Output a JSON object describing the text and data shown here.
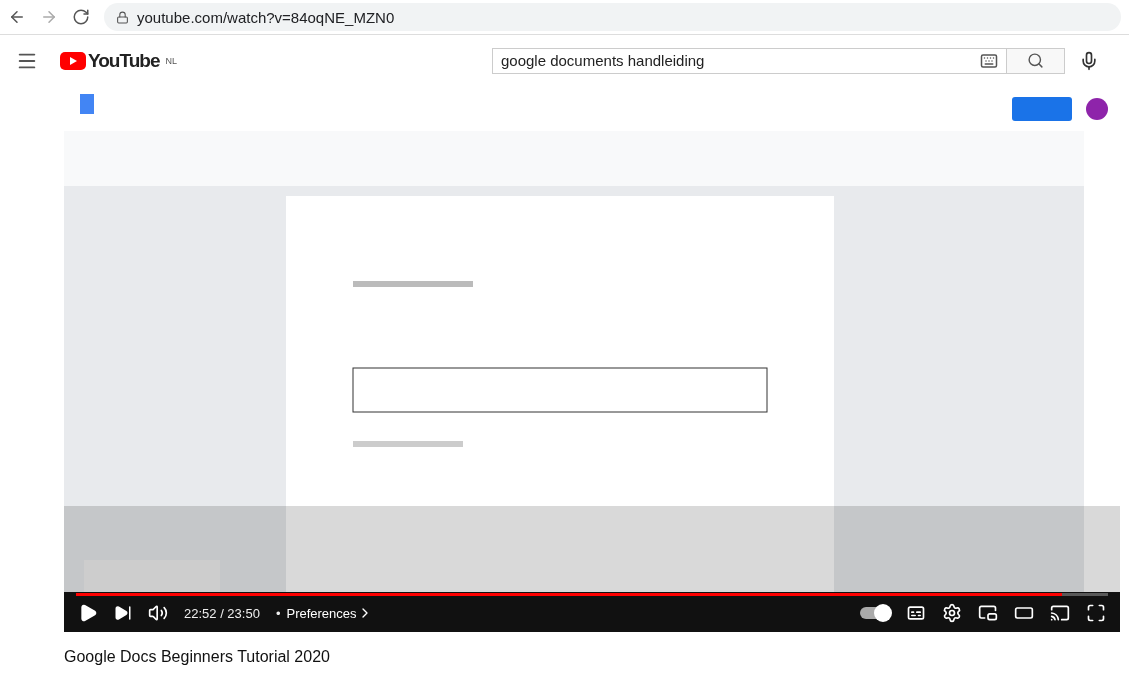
{
  "browser": {
    "url": "youtube.com/watch?v=84oqNE_MZN0"
  },
  "header": {
    "logo": "YouTube",
    "region": "NL",
    "search": {
      "value": "google documents handleiding"
    }
  },
  "player": {
    "progress": {
      "level": 0.955
    },
    "time": "22:52 / 23:50",
    "separator": "•",
    "chapter": "Preferences",
    "autoplay": {
      "on": true
    }
  },
  "title": "Google Docs Beginners Tutorial 2020"
}
